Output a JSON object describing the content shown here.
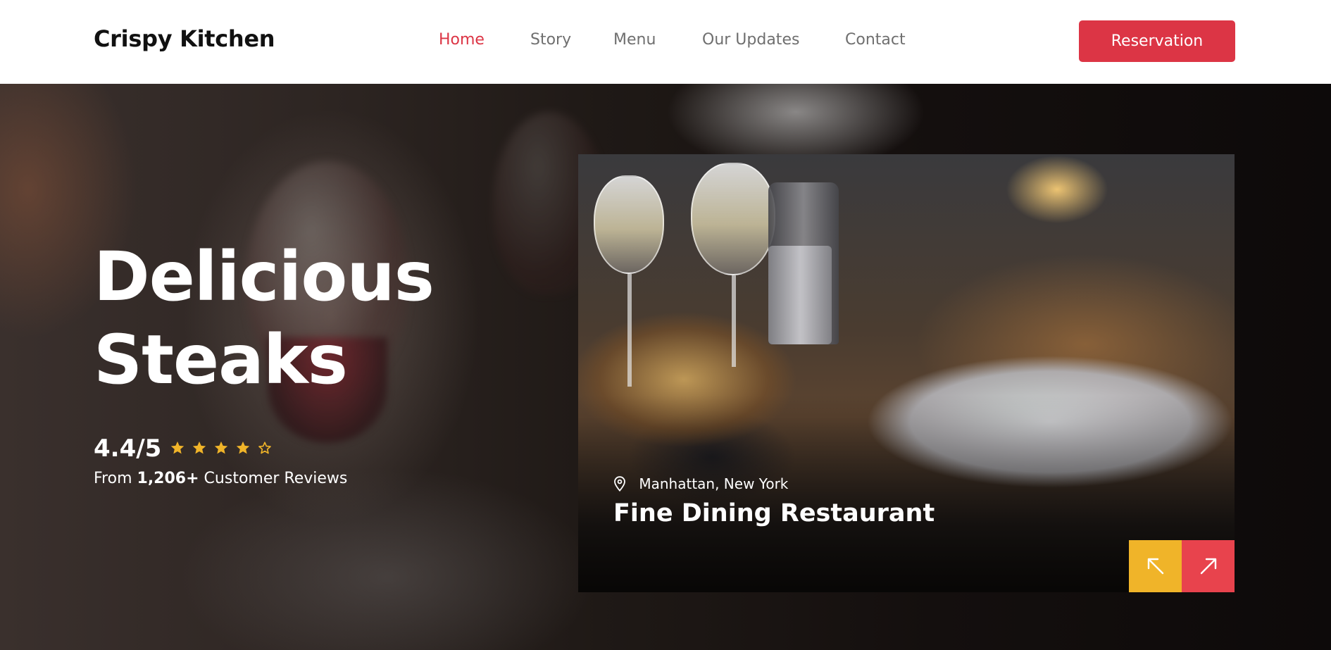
{
  "header": {
    "brand": "Crispy Kitchen",
    "nav": [
      {
        "label": "Home",
        "active": true
      },
      {
        "label": "Story",
        "active": false
      },
      {
        "label": "Menu",
        "active": false
      },
      {
        "label": "Our Updates",
        "active": false
      },
      {
        "label": "Contact",
        "active": false
      }
    ],
    "reservation_label": "Reservation"
  },
  "hero": {
    "title_line1": "Delicious",
    "title_line2": "Steaks",
    "rating_value": "4.4/5",
    "rating_stars": {
      "filled": 4,
      "total": 5,
      "icons": [
        "star-filled-icon",
        "star-outline-icon"
      ]
    },
    "reviews_prefix": "From",
    "reviews_count": "1,206+",
    "reviews_suffix": "Customer Reviews"
  },
  "card": {
    "location": "Manhattan, New York",
    "title": "Fine Dining Restaurant",
    "icons": [
      "map-pin-icon",
      "arrow-up-left-icon",
      "arrow-up-right-icon"
    ]
  },
  "colors": {
    "accent_red": "#dc3545",
    "star_gold": "#f0b429",
    "prev_button": "#f0b429",
    "next_button": "#e8434d",
    "nav_text": "#6f6f6f"
  }
}
